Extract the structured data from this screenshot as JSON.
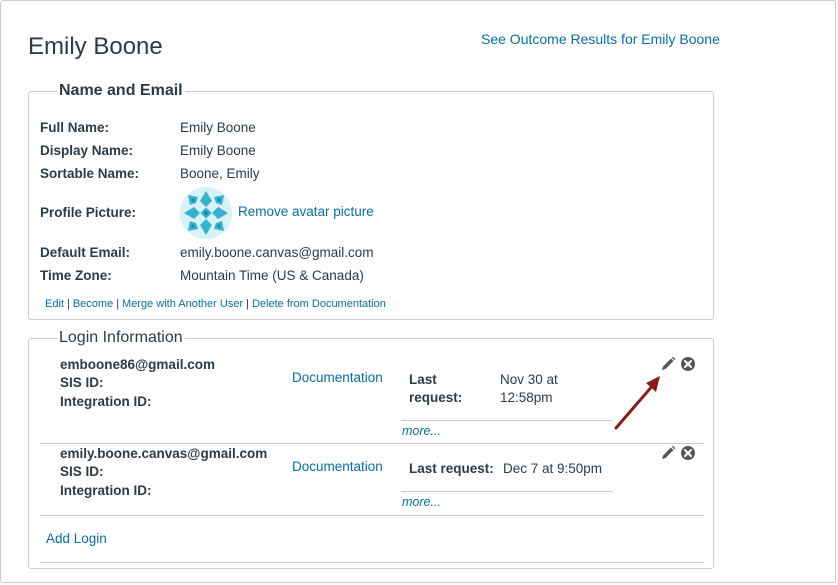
{
  "user": {
    "name": "Emily Boone",
    "outcome_link": "See Outcome Results for Emily Boone"
  },
  "name_email": {
    "legend": "Name and Email",
    "labels": {
      "full_name": "Full Name:",
      "display_name": "Display Name:",
      "sortable_name": "Sortable Name:",
      "profile_picture": "Profile Picture:",
      "default_email": "Default Email:",
      "time_zone": "Time Zone:"
    },
    "values": {
      "full_name": "Emily Boone",
      "display_name": "Emily Boone",
      "sortable_name": "Boone, Emily",
      "default_email": "emily.boone.canvas@gmail.com",
      "time_zone": "Mountain Time (US & Canada)"
    },
    "remove_avatar": "Remove avatar picture",
    "actions": [
      "Edit",
      "Become",
      "Merge with Another User",
      "Delete from Documentation"
    ],
    "separator": "|"
  },
  "login_info": {
    "legend": "Login Information",
    "sis_label": "SIS ID:",
    "integration_label": "Integration ID:",
    "more": "more...",
    "logins": [
      {
        "login_id": "emboone86@gmail.com",
        "auth_provider": "Documentation",
        "last_request_label_line1": "Last",
        "last_request_label_line2": "request:",
        "last_request_value_line1": "Nov 30 at",
        "last_request_value_line2": "12:58pm"
      },
      {
        "login_id": "emily.boone.canvas@gmail.com",
        "auth_provider": "Documentation",
        "last_request_label": "Last request:",
        "last_request_value": "Dec 7 at 9:50pm"
      }
    ],
    "add_login": "Add Login"
  },
  "icons": {
    "edit": "pencil-icon",
    "delete": "close-circle-icon",
    "annotation": "arrow-annotation"
  },
  "colors": {
    "link": "#0770a3",
    "text": "#2d3b45",
    "border": "#c7cdd1",
    "arrow": "#8b1a1a"
  }
}
